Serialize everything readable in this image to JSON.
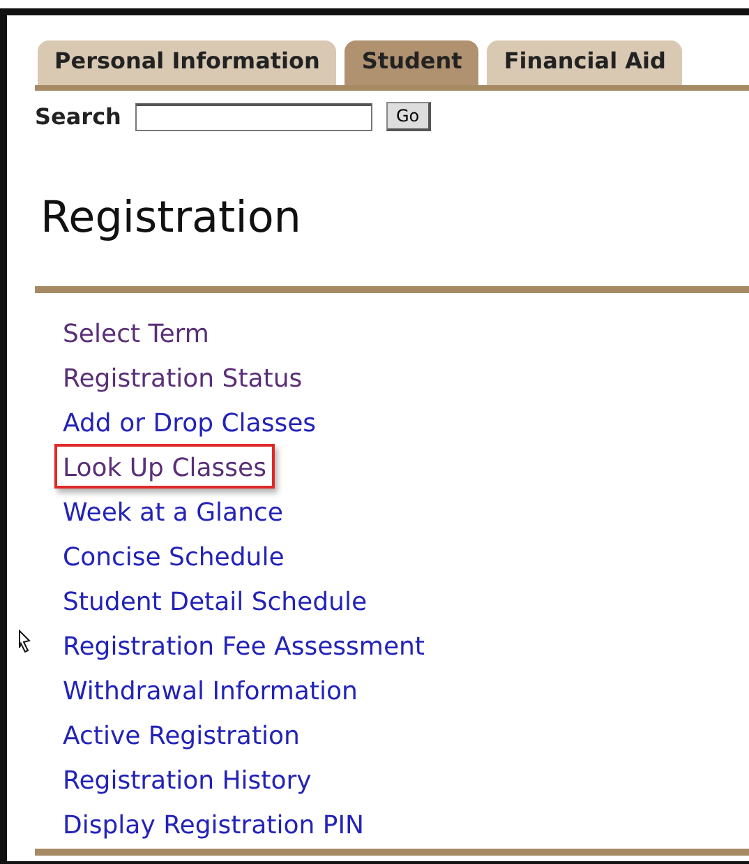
{
  "tabs": [
    {
      "label": "Personal Information",
      "selected": false
    },
    {
      "label": "Student",
      "selected": true
    },
    {
      "label": "Financial Aid",
      "selected": false
    }
  ],
  "search": {
    "label": "Search",
    "button": "Go"
  },
  "heading": "Registration",
  "links": [
    {
      "label": "Select Term",
      "visited": true,
      "highlighted": false
    },
    {
      "label": "Registration Status",
      "visited": true,
      "highlighted": false
    },
    {
      "label": "Add or Drop Classes",
      "visited": false,
      "highlighted": false
    },
    {
      "label": "Look Up Classes",
      "visited": true,
      "highlighted": true
    },
    {
      "label": "Week at a Glance",
      "visited": false,
      "highlighted": false
    },
    {
      "label": "Concise Schedule",
      "visited": false,
      "highlighted": false
    },
    {
      "label": "Student Detail Schedule",
      "visited": false,
      "highlighted": false
    },
    {
      "label": "Registration Fee Assessment",
      "visited": false,
      "highlighted": false
    },
    {
      "label": "Withdrawal Information",
      "visited": false,
      "highlighted": false
    },
    {
      "label": "Active Registration",
      "visited": false,
      "highlighted": false
    },
    {
      "label": "Registration History",
      "visited": false,
      "highlighted": false
    },
    {
      "label": "Display Registration PIN",
      "visited": false,
      "highlighted": false
    }
  ]
}
